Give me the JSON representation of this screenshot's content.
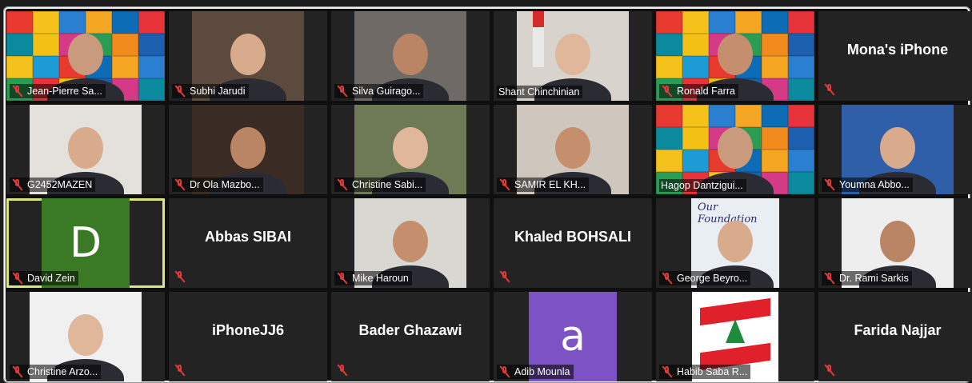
{
  "participants": [
    {
      "name": "Jean-Pierre Sa...",
      "muted": true,
      "kind": "video",
      "bg": "rotary"
    },
    {
      "name": "Subhi Jarudi",
      "muted": true,
      "kind": "video",
      "bg": "#5b4a3d"
    },
    {
      "name": "Silva Guirago...",
      "muted": true,
      "kind": "video",
      "bg": "#6f6a66"
    },
    {
      "name": "Shant Chinchinian",
      "muted": false,
      "kind": "video",
      "bg": "#d8d3cc"
    },
    {
      "name": "Ronald Farra",
      "muted": true,
      "kind": "video",
      "bg": "rotary"
    },
    {
      "name": "Mona's iPhone",
      "muted": true,
      "kind": "name-only"
    },
    {
      "name": "G2452MAZEN",
      "muted": true,
      "kind": "video",
      "bg": "#e4e1dc"
    },
    {
      "name": "Dr Ola Mazbo...",
      "muted": true,
      "kind": "video",
      "bg": "#3a2c25"
    },
    {
      "name": "Christine Sabi...",
      "muted": true,
      "kind": "video",
      "bg": "#6e7a55"
    },
    {
      "name": "SAMIR EL KH...",
      "muted": true,
      "kind": "video",
      "bg": "#cfc7bd"
    },
    {
      "name": "Hagop Dantzigui...",
      "muted": false,
      "kind": "video",
      "bg": "rotary"
    },
    {
      "name": "Youmna Abbo...",
      "muted": true,
      "kind": "video",
      "bg": "#2f5fa8"
    },
    {
      "name": "David Zein",
      "muted": true,
      "kind": "letter",
      "letter": "D",
      "color": "#3a7a24",
      "active_speaker": true
    },
    {
      "name": "Abbas SIBAI",
      "muted": true,
      "kind": "name-only"
    },
    {
      "name": "Mike Haroun",
      "muted": true,
      "kind": "video",
      "bg": "#d9d7d2"
    },
    {
      "name": "Khaled BOHSALI",
      "muted": true,
      "kind": "name-only"
    },
    {
      "name": "George Beyro...",
      "muted": true,
      "kind": "video",
      "bg": "foundation",
      "overlay_text": "Our Foundation"
    },
    {
      "name": "Dr. Rami Sarkis",
      "muted": true,
      "kind": "video",
      "bg": "#eeeeee"
    },
    {
      "name": "Christine Arzo...",
      "muted": true,
      "kind": "video",
      "bg": "#f0f0f0"
    },
    {
      "name": "iPhoneJJ6",
      "muted": true,
      "kind": "name-only"
    },
    {
      "name": "Bader Ghazawi",
      "muted": true,
      "kind": "name-only"
    },
    {
      "name": "Adib Mounla",
      "muted": true,
      "kind": "letter",
      "letter": "a",
      "color": "#7c52c4"
    },
    {
      "name": "Habib Saba R...",
      "muted": true,
      "kind": "video",
      "bg": "lebanon-flag"
    },
    {
      "name": "Farida Najjar",
      "muted": true,
      "kind": "name-only"
    }
  ],
  "colors": {
    "tile_bg": "#232323",
    "active_speaker_border": "#dde67a",
    "muted_icon": "#e03a3a"
  }
}
